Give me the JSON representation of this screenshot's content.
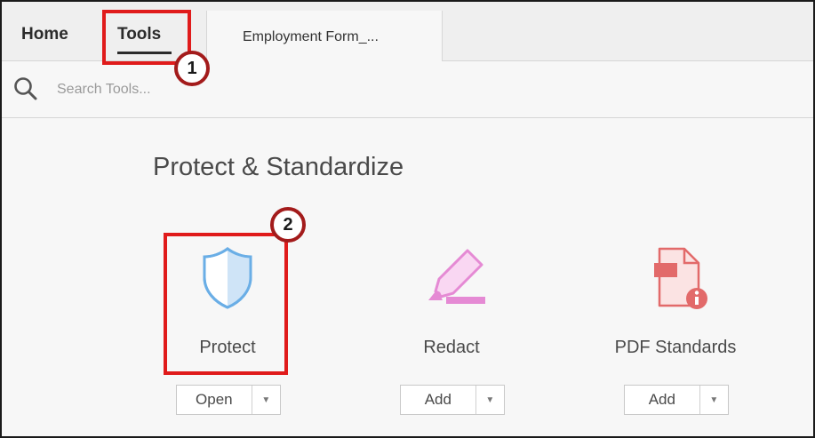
{
  "tabs": {
    "home": "Home",
    "tools": "Tools",
    "document": "Employment Form_..."
  },
  "search": {
    "placeholder": "Search Tools..."
  },
  "section": {
    "title": "Protect & Standardize"
  },
  "tools": [
    {
      "label": "Protect",
      "button": "Open",
      "icon": "shield-icon",
      "color": "#6aaee6"
    },
    {
      "label": "Redact",
      "button": "Add",
      "icon": "marker-icon",
      "color": "#e58ad4"
    },
    {
      "label": "PDF Standards",
      "button": "Add",
      "icon": "pdf-standards-icon",
      "color": "#e26a6a"
    }
  ],
  "annotations": {
    "badge1": "1",
    "badge2": "2",
    "color": "#e01b1b"
  }
}
